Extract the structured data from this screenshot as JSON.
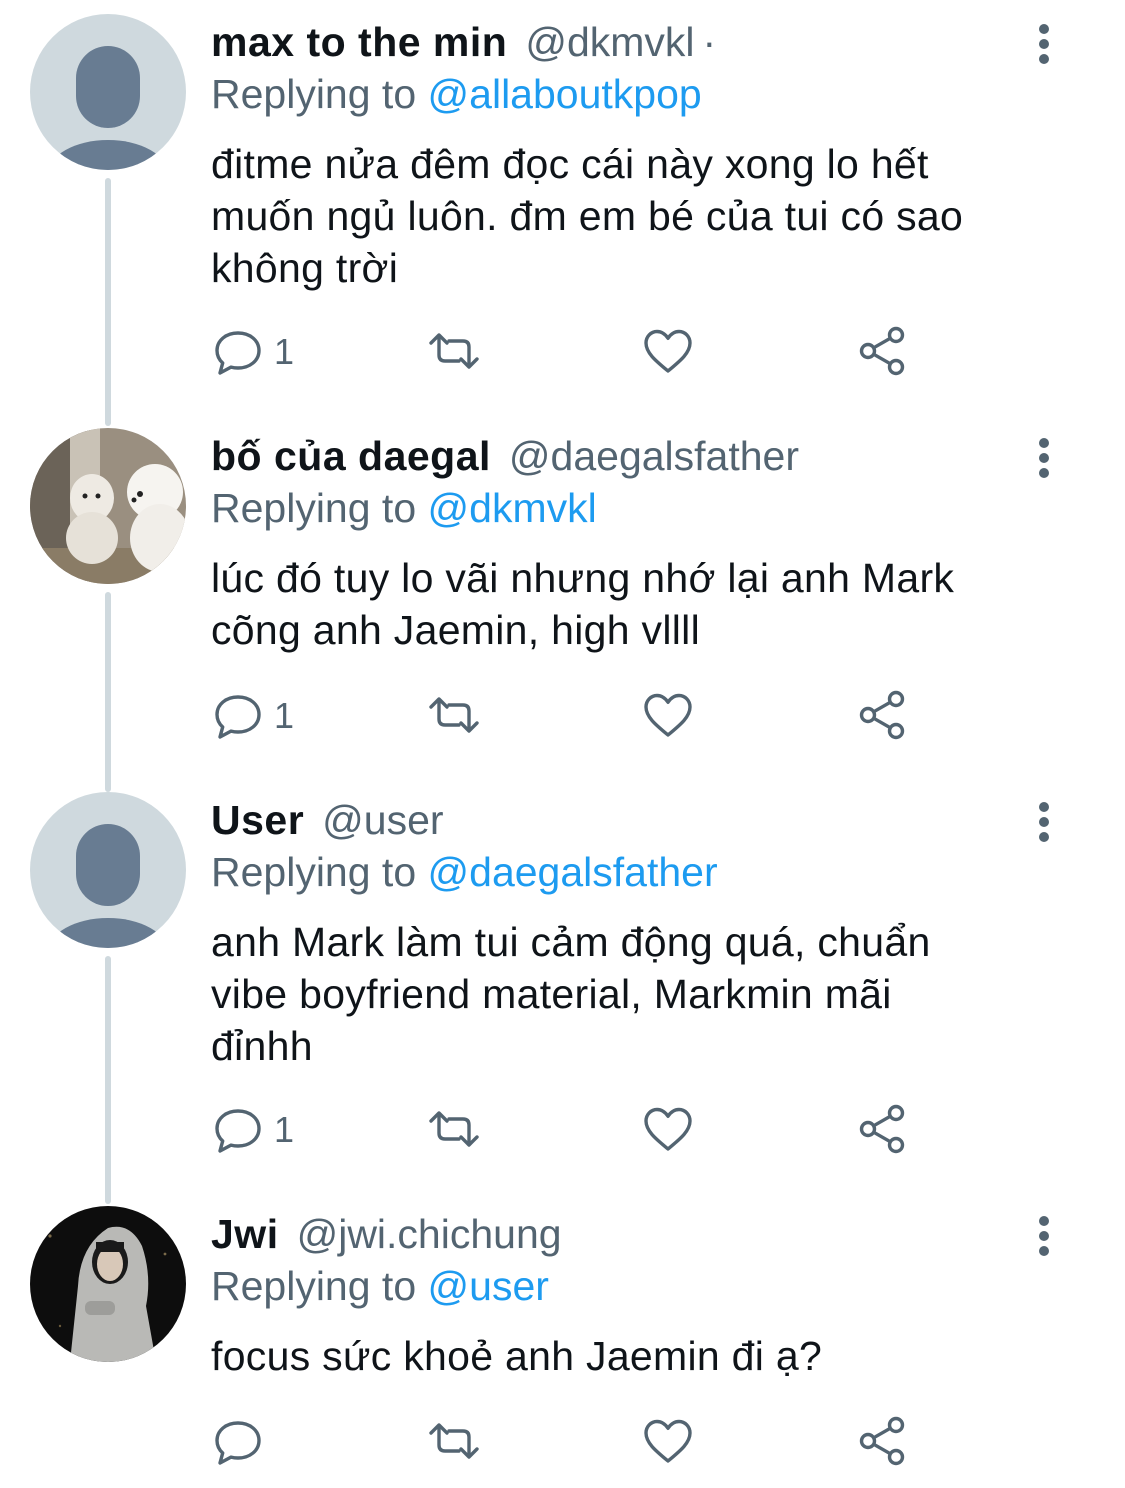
{
  "replying_prefix": "Replying to",
  "colors": {
    "name": "#0f1419",
    "secondary": "#536471",
    "link": "#1d9bf0",
    "thread_line": "#cfd9de",
    "default_avatar_bg": "#cfd9de",
    "default_avatar_fg": "#687c92"
  },
  "tweets": [
    {
      "name": "max to the min",
      "handle": "@dkmvkl",
      "separator": "·",
      "replying_to": "@allaboutkpop",
      "text_lines": [
        "đitme nửa đêm đọc cái này xong lo hết",
        "muốn ngủ luôn. đm em bé của tui có sao",
        "không trời"
      ],
      "reply_count": "1",
      "avatar": "default-avatar"
    },
    {
      "name": "bố của daegal",
      "handle": "@daegalsfather",
      "replying_to": "@dkmvkl",
      "text_lines": [
        "lúc đó tuy lo vãi nhưng nhớ lại anh Mark",
        "cõng anh Jaemin, high vllll"
      ],
      "reply_count": "1",
      "avatar": "dog-photo-avatar"
    },
    {
      "name": "User",
      "handle": "@user",
      "replying_to": "@daegalsfather",
      "text_lines": [
        "anh Mark làm tui cảm động quá, chuẩn",
        "vibe boyfriend material, Markmin mãi",
        "đỉnhh"
      ],
      "reply_count": "1",
      "avatar": "default-avatar"
    },
    {
      "name": "Jwi",
      "handle": "@jwi.chichung",
      "replying_to": "@user",
      "text_lines": [
        "focus sức khoẻ anh Jaemin đi ạ?"
      ],
      "reply_count": "",
      "avatar": "hoodie-photo-avatar"
    }
  ],
  "icons": {
    "reply": "reply-icon",
    "retweet": "retweet-icon",
    "like": "heart-icon",
    "share": "share-icon",
    "more": "more-vertical-icon"
  }
}
